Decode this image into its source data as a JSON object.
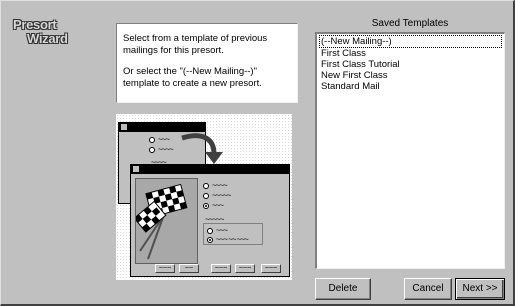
{
  "logo": {
    "line1": "Presort",
    "line2": "Wizard"
  },
  "instructions": {
    "paragraph1": "Select from a template of previous mailings for this presort.",
    "paragraph2": "Or select the \"(--New Mailing--)\" template to create a new presort."
  },
  "saved_templates": {
    "label": "Saved Templates",
    "items": [
      {
        "label": "(--New Mailing--)",
        "selected": true
      },
      {
        "label": "First Class",
        "selected": false
      },
      {
        "label": "First Class Tutorial",
        "selected": false
      },
      {
        "label": "New First Class",
        "selected": false
      },
      {
        "label": "Standard Mail",
        "selected": false
      }
    ]
  },
  "buttons": {
    "delete": "Delete",
    "cancel": "Cancel",
    "next": "Next >>"
  },
  "colors": {
    "dialog_bg": "#c0c0c0",
    "panel_bg": "#ffffff",
    "titlebar": "#000000"
  },
  "icons": [
    "checkered-flag-icon",
    "curved-arrow-icon"
  ]
}
